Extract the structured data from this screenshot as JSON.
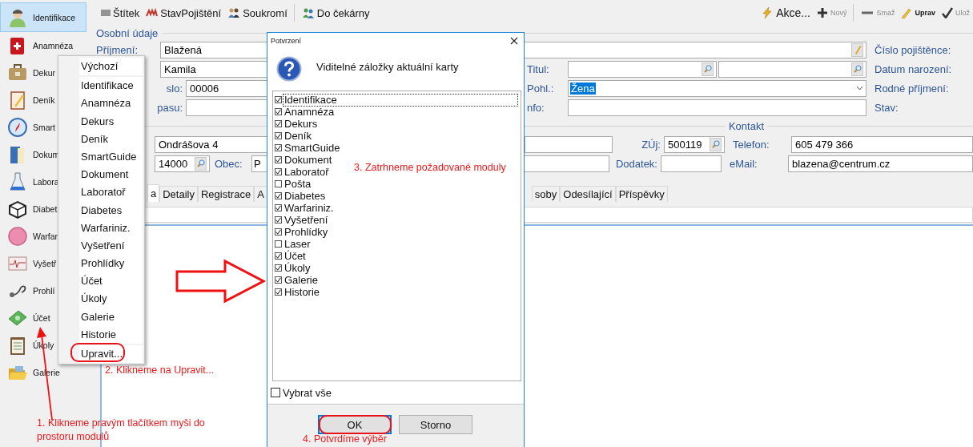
{
  "sidebar": {
    "items": [
      {
        "label": "Identifikace",
        "selected": true
      },
      {
        "label": "Anamnéza",
        "selected": false
      },
      {
        "label": "Dekur",
        "selected": false
      },
      {
        "label": "Deník",
        "selected": false
      },
      {
        "label": "Smart",
        "selected": false
      },
      {
        "label": "Dokum",
        "selected": false
      },
      {
        "label": "Labora",
        "selected": false
      },
      {
        "label": "Diabet",
        "selected": false
      },
      {
        "label": "Warfar",
        "selected": false
      },
      {
        "label": "Vyšetř",
        "selected": false
      },
      {
        "label": "Prohlí",
        "selected": false
      },
      {
        "label": "Účet",
        "selected": false
      },
      {
        "label": "Úkoly",
        "selected": false
      },
      {
        "label": "Galerie",
        "selected": false
      }
    ]
  },
  "toolbar": {
    "left": [
      {
        "label": "Štítek",
        "separated": false
      },
      {
        "label": "StavPojištění",
        "separated": false
      },
      {
        "label": "Soukromí",
        "separated": false
      },
      {
        "label": "Do čekárny",
        "separated": true
      }
    ],
    "right": [
      {
        "label": "Akce...",
        "kind": "menu",
        "disabled": false,
        "separated": false
      },
      {
        "label": "Nový",
        "kind": "action",
        "disabled": true,
        "separated": false
      },
      {
        "label": "Smaž",
        "kind": "action",
        "disabled": true,
        "separated": true
      },
      {
        "label": "Uprav",
        "kind": "action",
        "disabled": false,
        "separated": false
      },
      {
        "label": "Ulož",
        "kind": "action",
        "disabled": true,
        "separated": false
      }
    ]
  },
  "personal": {
    "title": "Osobní údaje",
    "surname_label": "Příjmení:",
    "surname": "Blažená",
    "first_name": "Kamila",
    "birth_number_label": "slo:",
    "birth_number": "00006",
    "passport_label": "pasu:",
    "title_label": "Titul:",
    "gender_label": "Pohl.:",
    "gender": "Žena",
    "info_label": "nfo:",
    "side_labels": [
      "Číslo pojištěnce:",
      "Datum narození:",
      "Rodné příjmení:",
      "Stav:"
    ]
  },
  "contact": {
    "title": "Kontakt",
    "street": "Ondrášova 4",
    "zip": "14000",
    "city_label": "Obec:",
    "city": "P",
    "zuj_label": "ZÚj:",
    "zuj": "500119",
    "addition_label": "Dodatek:",
    "phone_label": "Telefon:",
    "phone": "605 479 366",
    "email_label": "eMail:",
    "email": "blazena@centrum.cz"
  },
  "tabs": {
    "left": [
      {
        "label": "a",
        "selected": true
      },
      {
        "label": "Detaily",
        "selected": false
      },
      {
        "label": "Registrace",
        "selected": false
      },
      {
        "label": "A",
        "selected": false
      }
    ],
    "right": [
      {
        "label": "soby",
        "selected": false
      },
      {
        "label": "Odesílající",
        "selected": false
      },
      {
        "label": "Příspěvky",
        "selected": false
      }
    ]
  },
  "context_menu": {
    "sections": [
      [
        "Výchozí"
      ],
      [
        "Identifikace",
        "Anamnéza",
        "Dekurs",
        "Deník",
        "SmartGuide",
        "Dokument",
        "Laboratoř",
        "Diabetes",
        "Warfariniz.",
        "Vyšetření",
        "Prohlídky",
        "Účet",
        "Úkoly",
        "Galerie",
        "Historie"
      ],
      [
        "Upravit..."
      ]
    ]
  },
  "dialog": {
    "title": "Potvrzení",
    "message": "Viditelné záložky aktuální karty",
    "options": [
      {
        "label": "Identifikace",
        "checked": true,
        "focused": true
      },
      {
        "label": "Anamnéza",
        "checked": true,
        "focused": false
      },
      {
        "label": "Dekurs",
        "checked": true,
        "focused": false
      },
      {
        "label": "Deník",
        "checked": true,
        "focused": false
      },
      {
        "label": "SmartGuide",
        "checked": true,
        "focused": false
      },
      {
        "label": "Dokument",
        "checked": true,
        "focused": false
      },
      {
        "label": "Laboratoř",
        "checked": true,
        "focused": false
      },
      {
        "label": "Pošta",
        "checked": false,
        "focused": false
      },
      {
        "label": "Diabetes",
        "checked": true,
        "focused": false
      },
      {
        "label": "Warfariniz.",
        "checked": true,
        "focused": false
      },
      {
        "label": "Vyšetření",
        "checked": true,
        "focused": false
      },
      {
        "label": "Prohlídky",
        "checked": true,
        "focused": false
      },
      {
        "label": "Laser",
        "checked": false,
        "focused": false
      },
      {
        "label": "Účet",
        "checked": true,
        "focused": false
      },
      {
        "label": "Úkoly",
        "checked": true,
        "focused": false
      },
      {
        "label": "Galerie",
        "checked": true,
        "focused": false
      },
      {
        "label": "Historie",
        "checked": true,
        "focused": false
      }
    ],
    "select_all": {
      "label": "Vybrat vše",
      "checked": false
    },
    "buttons": [
      {
        "label": "OK",
        "default": true
      },
      {
        "label": "Storno",
        "default": false
      }
    ]
  },
  "annotations": [
    {
      "text": "3. Zatrhneme požadované moduly"
    },
    {
      "text": "2. Klikneme na Upravit..."
    },
    {
      "text": "1. Klikneme pravým tlačítkem myši do prostoru modulů"
    },
    {
      "text": "4. Potvrdíme výběr"
    }
  ]
}
